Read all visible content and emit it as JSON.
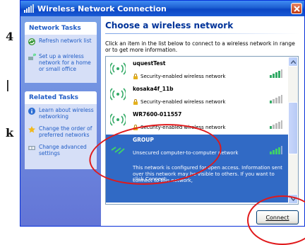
{
  "window": {
    "title": "Wireless Network Connection"
  },
  "doc_fragments": [
    "4",
    "|",
    "k"
  ],
  "sidebar": {
    "network_tasks": {
      "heading": "Network Tasks",
      "items": [
        {
          "label": "Refresh network list",
          "icon": "refresh-icon"
        },
        {
          "label": "Set up a wireless network for a home or small office",
          "icon": "setup-network-icon"
        }
      ]
    },
    "related_tasks": {
      "heading": "Related Tasks",
      "items": [
        {
          "label": "Learn about wireless networking",
          "icon": "info-icon"
        },
        {
          "label": "Change the order of preferred networks",
          "icon": "star-icon"
        },
        {
          "label": "Change advanced settings",
          "icon": "settings-icon"
        }
      ]
    }
  },
  "main": {
    "title": "Choose a wireless network",
    "intro": "Click an item in the list below to connect to a wireless network in range or to get more information.",
    "networks": [
      {
        "name": "uquestTest",
        "security": "Security-enabled wireless network"
      },
      {
        "name": "kosaka4f_11b",
        "security": "Security-enabled wireless network"
      },
      {
        "name": "WR7600-011557",
        "security": "Security-enabled wireless network"
      },
      {
        "name": "GROUP",
        "security": "Unsecured computer-to-computer network",
        "info": "This network is configured for open access. Information sent over this network may be visible to others. If you want to connect to this network,",
        "cut": "click Connect."
      }
    ],
    "connect_label": "Connect"
  },
  "colors": {
    "title_bar": "#0B46C4",
    "selection": "#316AC5",
    "annotation": "#E0191B",
    "task_link": "#215DC6"
  }
}
